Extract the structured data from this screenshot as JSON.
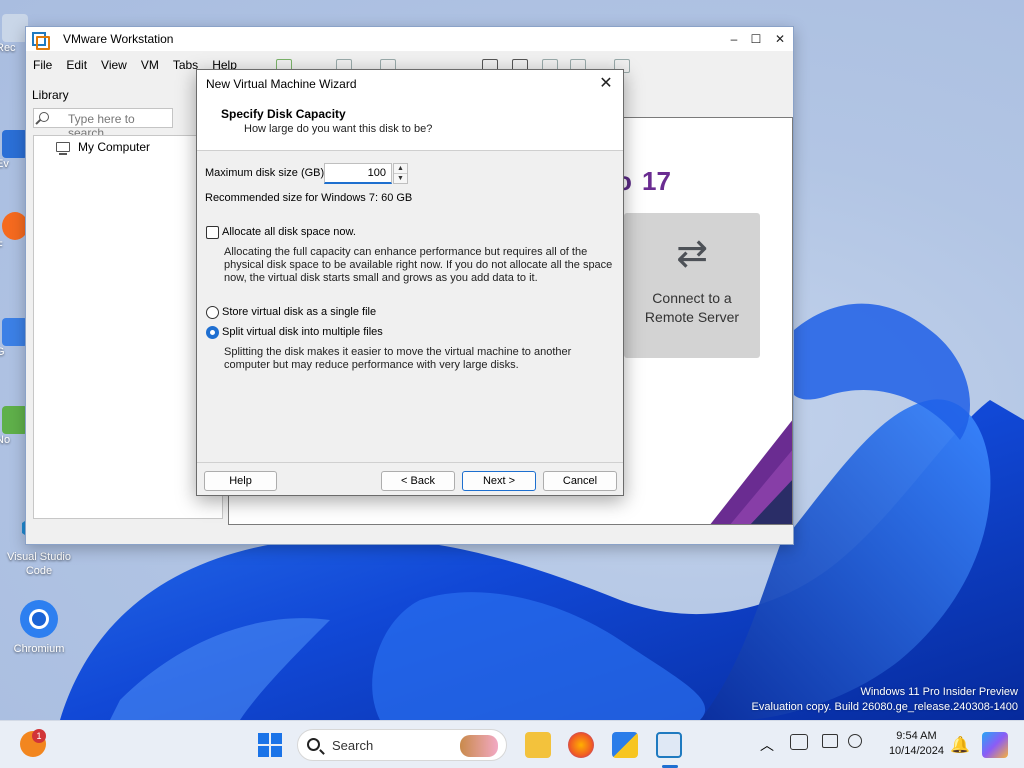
{
  "desktop": {
    "icons": [
      {
        "label": "Visual Studio\nCode"
      },
      {
        "label": "Chromium"
      }
    ],
    "partial_icons": [
      "Rec",
      "Ev",
      "F",
      "G",
      "No"
    ],
    "watermark": {
      "line1": "Windows 11 Pro Insider Preview",
      "line2": "Evaluation copy. Build 26080.ge_release.240308-1400"
    }
  },
  "vmware": {
    "title": "VMware Workstation",
    "menu": [
      "File",
      "Edit",
      "View",
      "VM",
      "Tabs",
      "Help"
    ],
    "library": {
      "heading": "Library",
      "search_placeholder": "Type here to search",
      "tree": [
        "My Computer"
      ]
    },
    "home": {
      "version": "17",
      "remote_card": {
        "line1": "Connect to a",
        "line2": "Remote Server"
      }
    }
  },
  "wizard": {
    "title": "New Virtual Machine Wizard",
    "header": "Specify Disk Capacity",
    "subheader": "How large do you want this disk to be?",
    "max_size_label": "Maximum disk size (GB):",
    "max_size_value": "100",
    "recommended": "Recommended size for Windows 7: 60 GB",
    "allocate_label": "Allocate all disk space now.",
    "allocate_checked": false,
    "allocate_desc": "Allocating the full capacity can enhance performance but requires all of the physical disk space to be available right now. If you do not allocate all the space now, the virtual disk starts small and grows as you add data to it.",
    "radio_single": "Store virtual disk as a single file",
    "radio_split": "Split virtual disk into multiple files",
    "selected": "split",
    "split_desc": "Splitting the disk makes it easier to move the virtual machine to another computer but may reduce performance with very large disks.",
    "buttons": {
      "help": "Help",
      "back": "< Back",
      "next": "Next >",
      "cancel": "Cancel"
    }
  },
  "taskbar": {
    "search_placeholder": "Search",
    "notification_count": "1",
    "time": "9:54 AM",
    "date": "10/14/2024"
  }
}
